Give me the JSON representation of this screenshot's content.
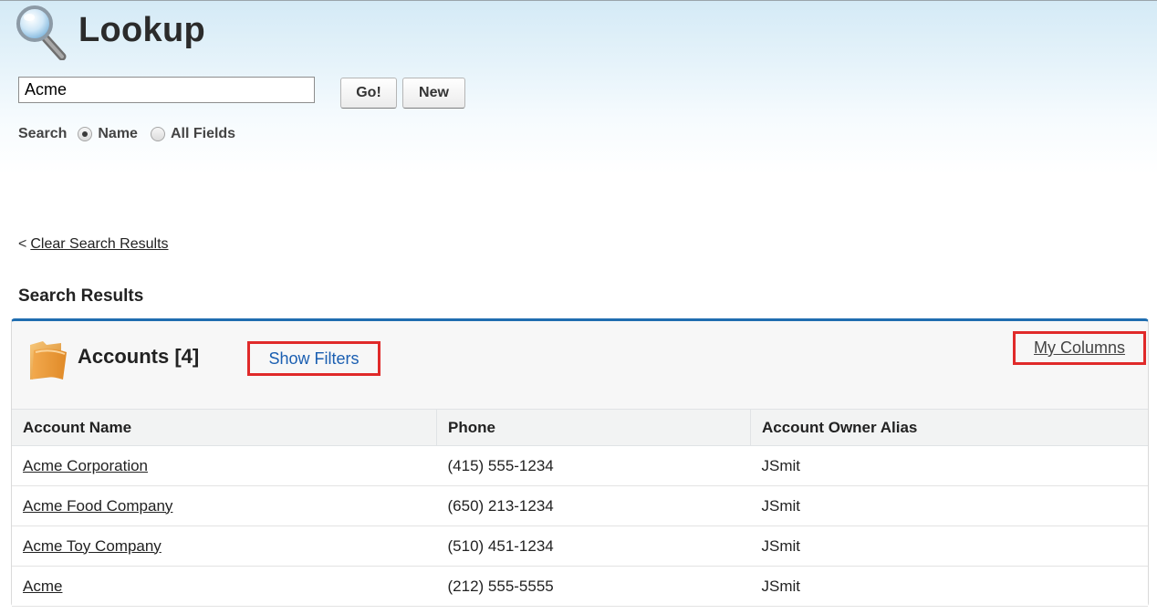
{
  "header": {
    "title": "Lookup",
    "icon": "magnifier-icon"
  },
  "search": {
    "value": "Acme",
    "go_label": "Go!",
    "new_label": "New",
    "options_label": "Search",
    "options": [
      {
        "label": "Name",
        "checked": true
      },
      {
        "label": "All Fields",
        "checked": false
      }
    ]
  },
  "clear_link": {
    "arrow": "<",
    "label": "Clear Search Results"
  },
  "results": {
    "heading": "Search Results",
    "panel_title": "Accounts [4]",
    "show_filters_label": "Show Filters",
    "my_columns_label": "My Columns",
    "accent_color": "#1f6db0",
    "highlight_color": "#e02a2a",
    "columns": [
      "Account Name",
      "Phone",
      "Account Owner Alias"
    ],
    "rows": [
      {
        "name": "Acme Corporation",
        "phone": "(415) 555-1234",
        "owner": "JSmit"
      },
      {
        "name": "Acme Food Company",
        "phone": "(650) 213-1234",
        "owner": "JSmit"
      },
      {
        "name": "Acme Toy Company",
        "phone": "(510) 451-1234",
        "owner": "JSmit"
      },
      {
        "name": "Acme",
        "phone": "(212) 555-5555",
        "owner": "JSmit"
      }
    ]
  }
}
